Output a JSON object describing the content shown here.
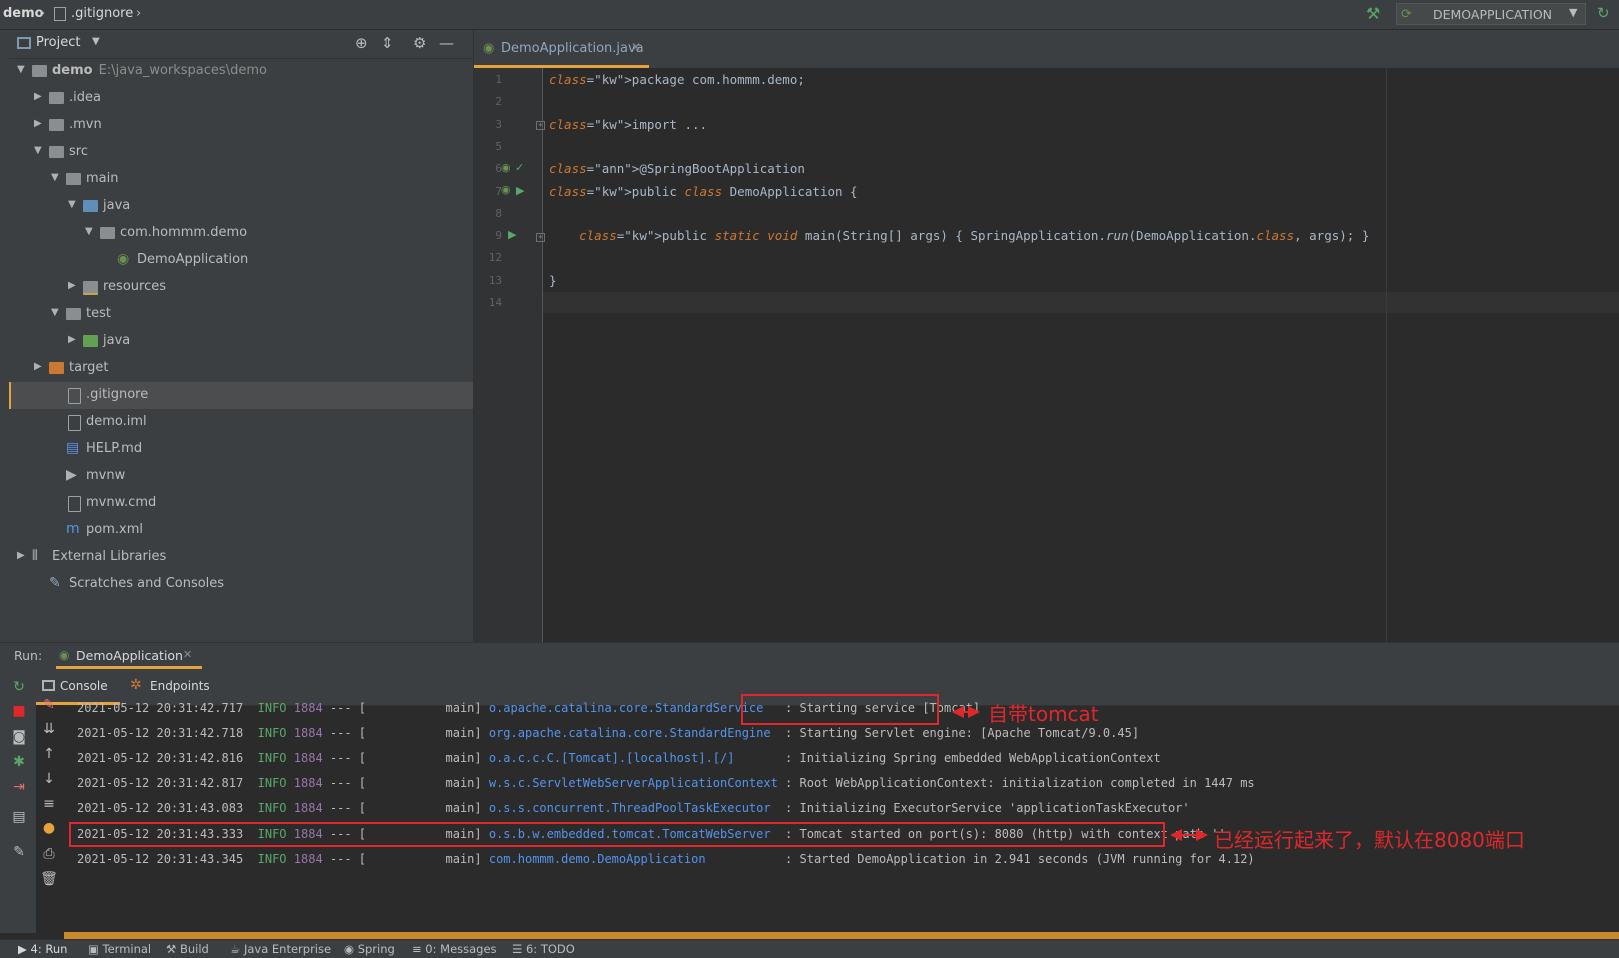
{
  "breadcrumb": {
    "project": "demo",
    "sep": "›",
    "file": ".gitignore"
  },
  "toolbar": {
    "run_config": "DEMOAPPLICATION",
    "run_config_arrow": "▼"
  },
  "project_panel": {
    "title": "Project",
    "tree": [
      {
        "label": "demo",
        "sub": "E:\\java_workspaces\\demo",
        "depth": 0,
        "expanded": true,
        "icon": "folder",
        "bold": true
      },
      {
        "label": ".idea",
        "depth": 1,
        "expanded": false,
        "icon": "folder"
      },
      {
        "label": ".mvn",
        "depth": 1,
        "expanded": false,
        "icon": "folder"
      },
      {
        "label": "src",
        "depth": 1,
        "expanded": true,
        "icon": "folder"
      },
      {
        "label": "main",
        "depth": 2,
        "expanded": true,
        "icon": "folder"
      },
      {
        "label": "java",
        "depth": 3,
        "expanded": true,
        "icon": "folder-blue"
      },
      {
        "label": "com.hommm.demo",
        "depth": 4,
        "expanded": true,
        "icon": "package"
      },
      {
        "label": "DemoApplication",
        "depth": 5,
        "icon": "spring-class"
      },
      {
        "label": "resources",
        "depth": 3,
        "expanded": false,
        "icon": "folder-resource"
      },
      {
        "label": "test",
        "depth": 2,
        "expanded": true,
        "icon": "folder"
      },
      {
        "label": "java",
        "depth": 3,
        "expanded": false,
        "icon": "folder-green"
      },
      {
        "label": "target",
        "depth": 1,
        "expanded": false,
        "icon": "folder-orange"
      },
      {
        "label": ".gitignore",
        "depth": 2,
        "icon": "file",
        "selected": true
      },
      {
        "label": "demo.iml",
        "depth": 2,
        "icon": "file"
      },
      {
        "label": "HELP.md",
        "depth": 2,
        "icon": "md-file"
      },
      {
        "label": "mvnw",
        "depth": 2,
        "icon": "shell-file"
      },
      {
        "label": "mvnw.cmd",
        "depth": 2,
        "icon": "file"
      },
      {
        "label": "pom.xml",
        "depth": 2,
        "icon": "maven-file"
      },
      {
        "label": "External Libraries",
        "depth": 0,
        "expanded": false,
        "icon": "libraries"
      },
      {
        "label": "Scratches and Consoles",
        "depth": 1,
        "icon": "scratches"
      }
    ]
  },
  "editor": {
    "tab": "DemoApplication.java",
    "lines": [
      {
        "n": "1",
        "t": "package com.hommm.demo;"
      },
      {
        "n": "2",
        "t": ""
      },
      {
        "n": "3",
        "t": "import ..."
      },
      {
        "n": "5",
        "t": ""
      },
      {
        "n": "6",
        "t": "@SpringBootApplication"
      },
      {
        "n": "7",
        "t": "public class DemoApplication {"
      },
      {
        "n": "8",
        "t": ""
      },
      {
        "n": "9",
        "t": "    public static void main(String[] args) { SpringApplication.run(DemoApplication.class, args); }"
      },
      {
        "n": "12",
        "t": ""
      },
      {
        "n": "13",
        "t": "}"
      },
      {
        "n": "14",
        "t": ""
      }
    ]
  },
  "run_panel": {
    "label": "Run:",
    "tab": "DemoApplication",
    "subtabs": [
      "Console",
      "Endpoints"
    ],
    "logs": [
      {
        "ts": "2021-05-12 20:31:42.717",
        "level": "INFO",
        "pid": "1884",
        "sep": "---",
        "thread": "[           main]",
        "logger": "o.apache.catalina.core.StandardService",
        "msg": ": Starting service [Tomcat]"
      },
      {
        "ts": "2021-05-12 20:31:42.718",
        "level": "INFO",
        "pid": "1884",
        "sep": "---",
        "thread": "[           main]",
        "logger": "org.apache.catalina.core.StandardEngine",
        "msg": ": Starting Servlet engine: [Apache Tomcat/9.0.45]"
      },
      {
        "ts": "2021-05-12 20:31:42.816",
        "level": "INFO",
        "pid": "1884",
        "sep": "---",
        "thread": "[           main]",
        "logger": "o.a.c.c.C.[Tomcat].[localhost].[/]",
        "msg": ": Initializing Spring embedded WebApplicationContext"
      },
      {
        "ts": "2021-05-12 20:31:42.817",
        "level": "INFO",
        "pid": "1884",
        "sep": "---",
        "thread": "[           main]",
        "logger": "w.s.c.ServletWebServerApplicationContext",
        "msg": ": Root WebApplicationContext: initialization completed in 1447 ms"
      },
      {
        "ts": "2021-05-12 20:31:43.083",
        "level": "INFO",
        "pid": "1884",
        "sep": "---",
        "thread": "[           main]",
        "logger": "o.s.s.concurrent.ThreadPoolTaskExecutor",
        "msg": ": Initializing ExecutorService 'applicationTaskExecutor'"
      },
      {
        "ts": "2021-05-12 20:31:43.333",
        "level": "INFO",
        "pid": "1884",
        "sep": "---",
        "thread": "[           main]",
        "logger": "o.s.b.w.embedded.tomcat.TomcatWebServer",
        "msg": ": Tomcat started on port(s): 8080 (http) with context path ''"
      },
      {
        "ts": "2021-05-12 20:31:43.345",
        "level": "INFO",
        "pid": "1884",
        "sep": "---",
        "thread": "[           main]",
        "logger": "com.hommm.demo.DemoApplication",
        "msg": ": Started DemoApplication in 2.941 seconds (JVM running for 4.12)"
      }
    ],
    "annotations": [
      "自带tomcat",
      "已经运行起来了，默认在8080端口"
    ]
  },
  "bottom_tabs": [
    "4: Run",
    "Terminal",
    "Build",
    "Java Enterprise",
    "Spring",
    "0: Messages",
    "6: TODO"
  ],
  "colors": {
    "accent": "#e6a23c",
    "annotation_red": "#e0272b",
    "info_green": "#59a869",
    "logger_blue": "#5394ec"
  }
}
